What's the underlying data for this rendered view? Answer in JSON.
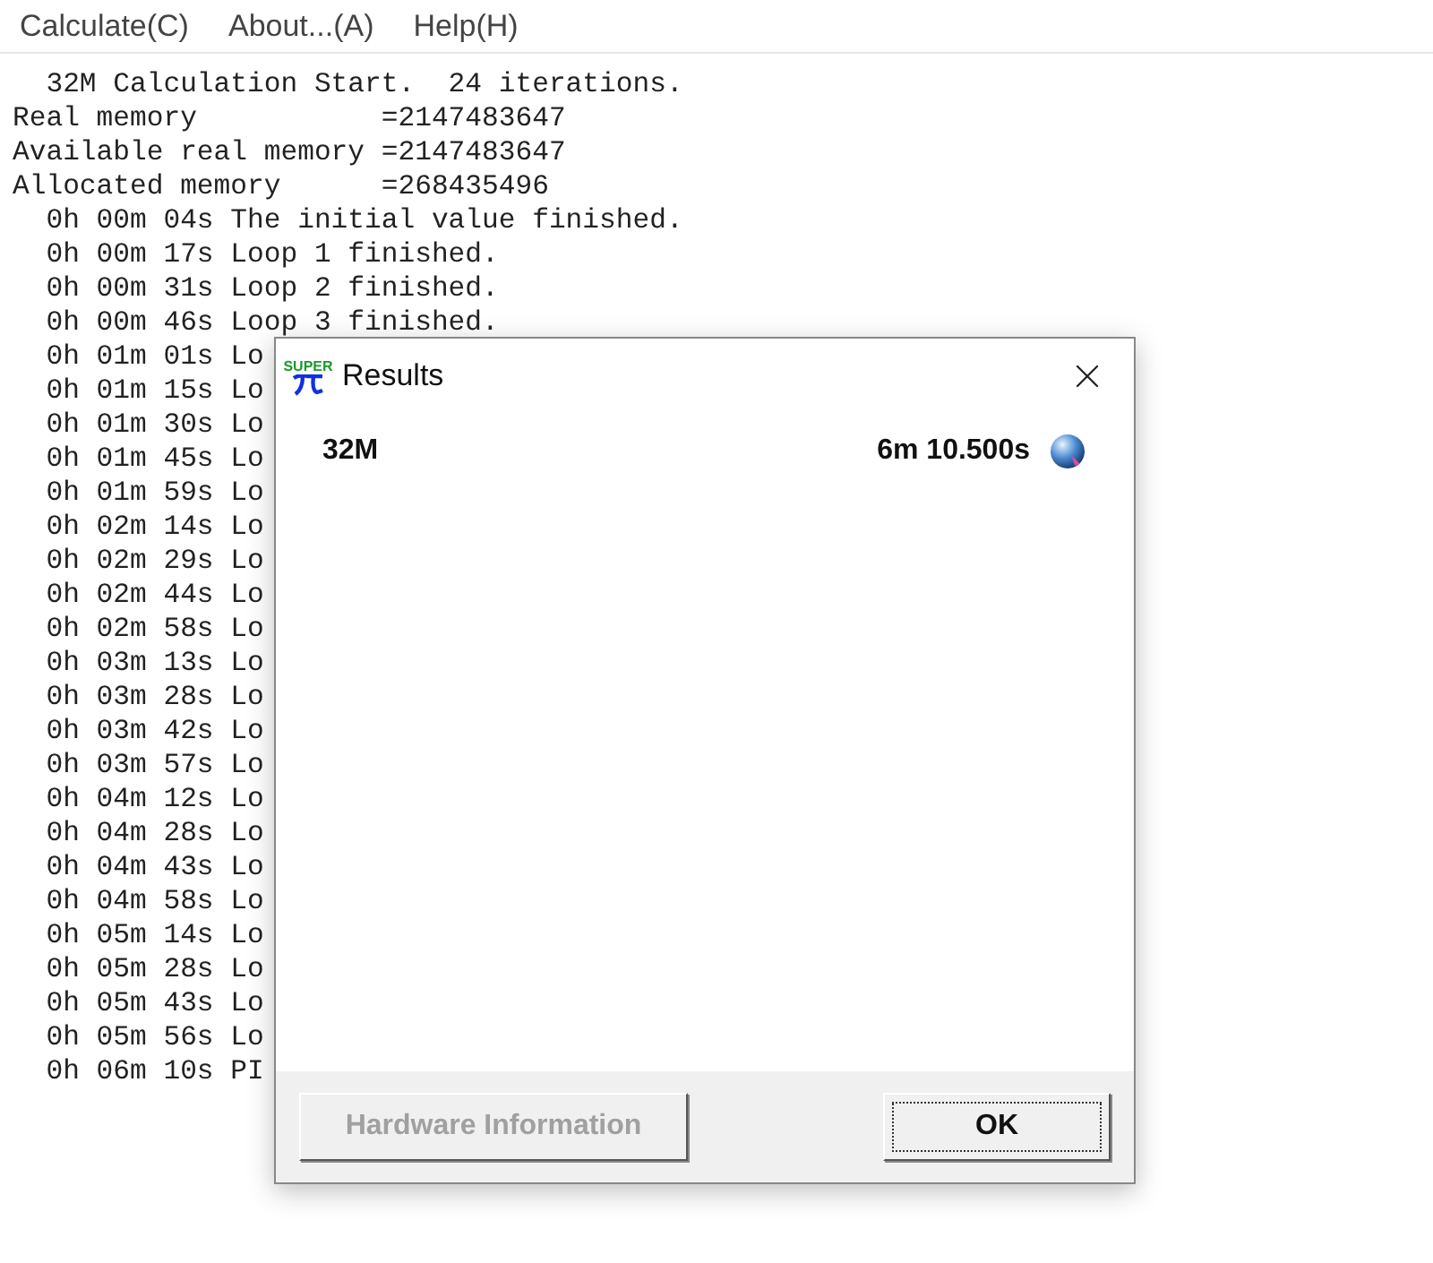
{
  "menu": [
    {
      "label": "Calculate(C)"
    },
    {
      "label": "About...(A)"
    },
    {
      "label": "Help(H)"
    }
  ],
  "log": [
    "  32M Calculation Start.  24 iterations.",
    "Real memory           =2147483647",
    "Available real memory =2147483647",
    "Allocated memory      =268435496",
    "  0h 00m 04s The initial value finished.",
    "  0h 00m 17s Loop 1 finished.",
    "  0h 00m 31s Loop 2 finished.",
    "  0h 00m 46s Loop 3 finished.",
    "  0h 01m 01s Lo",
    "  0h 01m 15s Lo",
    "  0h 01m 30s Lo",
    "  0h 01m 45s Lo",
    "  0h 01m 59s Lo",
    "  0h 02m 14s Lo",
    "  0h 02m 29s Lo",
    "  0h 02m 44s Lo",
    "  0h 02m 58s Lo",
    "  0h 03m 13s Lo",
    "  0h 03m 28s Lo",
    "  0h 03m 42s Lo",
    "  0h 03m 57s Lo",
    "  0h 04m 12s Lo",
    "  0h 04m 28s Lo",
    "  0h 04m 43s Lo",
    "  0h 04m 58s Lo",
    "  0h 05m 14s Lo",
    "  0h 05m 28s Lo",
    "  0h 05m 43s Lo",
    "  0h 05m 56s Lo",
    "  0h 06m 10s PI"
  ],
  "dialog": {
    "logo_text": "SUPER",
    "title": "Results",
    "result_label": "32M",
    "result_time": "6m 10.500s",
    "buttons": [
      {
        "label": "Hardware Information",
        "disabled": true,
        "focused": false
      },
      {
        "label": "OK",
        "disabled": false,
        "focused": true
      }
    ]
  }
}
